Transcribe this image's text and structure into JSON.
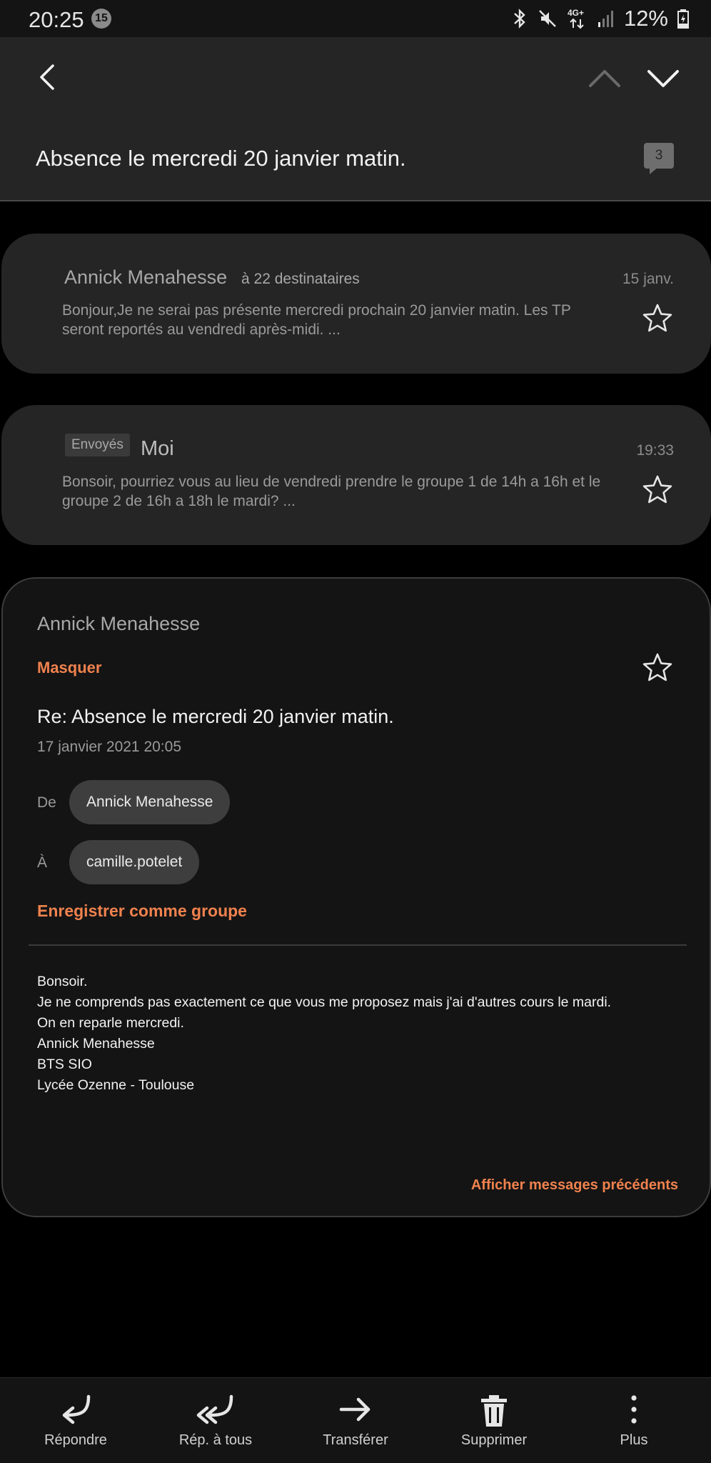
{
  "status_bar": {
    "time": "20:25",
    "notification_count": "15",
    "network": "4G+",
    "battery": "12%"
  },
  "header": {
    "thread_title": "Absence le mercredi 20 janvier matin.",
    "message_count": "3"
  },
  "messages": [
    {
      "sender": "Annick Menahesse",
      "recipients": "à 22 destinataires",
      "date": "15 janv.",
      "preview": "Bonjour,Je ne serai pas présente mercredi prochain 20 janvier matin. Les TP seront reportés au vendredi après-midi. ...",
      "starred": false
    },
    {
      "tag": "Envoyés",
      "sender": "Moi",
      "date": "19:33",
      "preview": "Bonsoir, pourriez vous au lieu de vendredi prendre le groupe 1 de 14h a 16h et le groupe 2 de 16h a 18h le mardi? ...",
      "starred": false
    }
  ],
  "expanded": {
    "sender": "Annick Menahesse",
    "hide_label": "Masquer",
    "subject": "Re: Absence le mercredi 20 janvier matin.",
    "datetime": "17 janvier 2021  20:05",
    "from_label": "De",
    "from_value": "Annick Menahesse",
    "to_label": "À",
    "to_value": "camille.potelet",
    "save_group_label": "Enregistrer comme groupe",
    "body": [
      "Bonsoir.",
      "Je ne comprends pas exactement ce que vous me proposez mais j'ai d'autres cours le mardi.",
      "On en reparle mercredi.",
      "Annick Menahesse",
      "BTS SIO",
      "Lycée Ozenne - Toulouse"
    ],
    "previous_messages_label": "Afficher messages précédents"
  },
  "bottom_bar": {
    "reply": "Répondre",
    "reply_all": "Rép. à tous",
    "forward": "Transférer",
    "delete": "Supprimer",
    "more": "Plus"
  },
  "colors": {
    "accent": "#f0824e",
    "card": "#252525",
    "background": "#000000"
  }
}
